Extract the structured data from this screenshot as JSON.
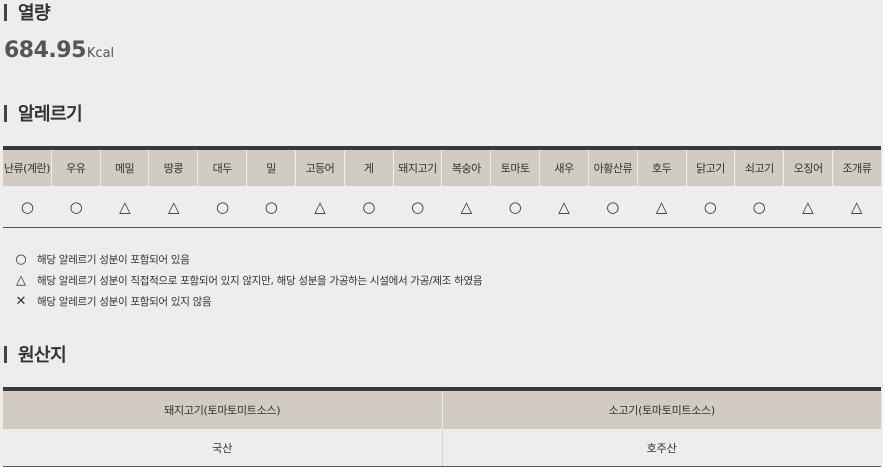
{
  "calorie": {
    "title": "열량",
    "value": "684.95",
    "unit": "Kcal"
  },
  "allergy": {
    "title": "알레르기",
    "headers": [
      "난류(계란)",
      "우유",
      "메밀",
      "땅콩",
      "대두",
      "밀",
      "고등어",
      "게",
      "돼지고기",
      "복숭아",
      "토마토",
      "새우",
      "아황산류",
      "호두",
      "닭고기",
      "쇠고기",
      "오징어",
      "조개류"
    ],
    "values": [
      "○",
      "○",
      "△",
      "△",
      "○",
      "○",
      "△",
      "○",
      "○",
      "△",
      "○",
      "△",
      "○",
      "△",
      "○",
      "○",
      "△",
      "△"
    ],
    "legend": [
      {
        "symbol": "○",
        "text": "해당 알레르기 성분이 포함되어 있음"
      },
      {
        "symbol": "△",
        "text": "해당 알레르기 성분이 직접적으로 포함되어 있지 않지만, 해당 성분을 가공하는 시설에서 가공/제조 하였음"
      },
      {
        "symbol": "✕",
        "text": "해당 알레르기 성분이 포함되어 있지 않음"
      }
    ]
  },
  "origin": {
    "title": "원산지",
    "headers": [
      "돼지고기(토마토미트소스)",
      "소고기(토마토미트소스)"
    ],
    "values": [
      "국산",
      "호주산"
    ]
  }
}
